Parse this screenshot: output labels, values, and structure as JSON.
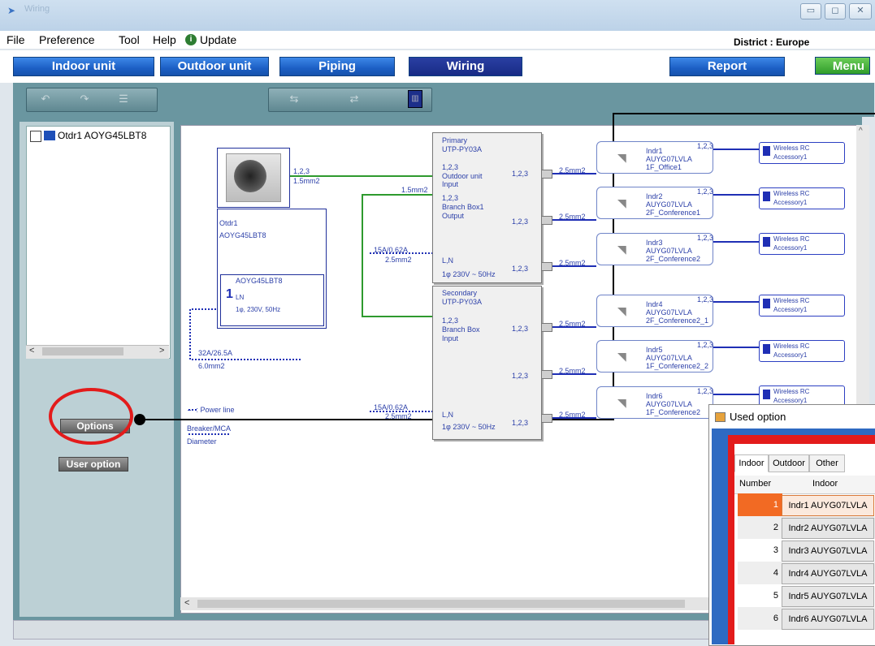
{
  "window": {
    "title": "Wiring",
    "minimize": "▭",
    "maximize": "◻",
    "close": "✕"
  },
  "menubar": {
    "file": "File",
    "preference": "Preference",
    "tool": "Tool",
    "help": "Help",
    "update": "Update",
    "district": "District : Europe"
  },
  "nav": {
    "indoor": "Indoor unit",
    "outdoor": "Outdoor unit",
    "piping": "Piping",
    "wiring": "Wiring",
    "report": "Report",
    "menu": "Menu"
  },
  "tree": {
    "item": "Otdr1 AOYG45LBT8"
  },
  "left": {
    "options": "Options",
    "user_option": "User option"
  },
  "outdoor": {
    "name1": "Otdr1",
    "name2": "AOYG45LBT8",
    "inner_model": "AOYG45LBT8",
    "number": "1",
    "ln": "LN",
    "supply": "1φ, 230V, 50Hz",
    "cable_spec": "1,2,3",
    "cable_size": "1.5mm2",
    "cable_size2": "1.5mm2",
    "breaker": "32A/26.5A",
    "breaker_size": "6.0mm2",
    "line1": "15A/0.62A",
    "line1_size": "2.5mm2",
    "line2": "15A/0.62A",
    "line2_size": "2.5mm2"
  },
  "legend": {
    "power": "··· : Power line",
    "breaker": "Breaker/MCA",
    "diameter": "Diameter"
  },
  "primary": {
    "title": "Primary",
    "model": "UTP-PY03A",
    "t1": "1,2,3",
    "t2": "Outdoor unit",
    "t3": "Input",
    "t4": "1,2,3",
    "t5": "Branch Box1",
    "t6": "Output",
    "ln": "L,N",
    "supply": "1φ 230V ~ 50Hz",
    "p1": "1,2,3",
    "p2": "1,2,3",
    "p3": "1,2,3"
  },
  "secondary": {
    "title": "Secondary",
    "model": "UTP-PY03A",
    "t1": "1,2,3",
    "t2": "Branch Box",
    "t3": "Input",
    "ln": "L,N",
    "supply": "1φ 230V ~ 50Hz",
    "p1": "1,2,3",
    "p2": "1,2,3",
    "p3": "1,2,3"
  },
  "cable": "2.5mm2",
  "indoor_units": [
    {
      "name": "Indr1",
      "model": "AUYG07LVLA",
      "room": "1F_Office1",
      "term": "1,2,3"
    },
    {
      "name": "Indr2",
      "model": "AUYG07LVLA",
      "room": "2F_Conference1",
      "term": "1,2,3"
    },
    {
      "name": "Indr3",
      "model": "AUYG07LVLA",
      "room": "2F_Conference2",
      "term": "1,2,3"
    },
    {
      "name": "Indr4",
      "model": "AUYG07LVLA",
      "room": "2F_Conference2_1",
      "term": "1,2,3"
    },
    {
      "name": "Indr5",
      "model": "AUYG07LVLA",
      "room": "1F_Conference2_2",
      "term": "1,2,3"
    },
    {
      "name": "Indr6",
      "model": "AUYG07LVLA",
      "room": "1F_Conference2",
      "term": "1,2,3"
    }
  ],
  "rc": {
    "line1": "Wireless RC",
    "line2": "Accessory1"
  },
  "dialog": {
    "title": "Used option",
    "tabs": [
      "Indoor",
      "Outdoor",
      "Other"
    ],
    "col_number": "Number",
    "col_indoor": "Indoor",
    "rows": [
      {
        "n": "1",
        "v": "Indr1 AUYG07LVLA"
      },
      {
        "n": "2",
        "v": "Indr2 AUYG07LVLA"
      },
      {
        "n": "3",
        "v": "Indr3 AUYG07LVLA"
      },
      {
        "n": "4",
        "v": "Indr4 AUYG07LVLA"
      },
      {
        "n": "5",
        "v": "Indr5 AUYG07LVLA"
      },
      {
        "n": "6",
        "v": "Indr6 AUYG07LVLA"
      }
    ]
  },
  "colors": {
    "accent": "#1c5fc4",
    "active": "#182b86",
    "menu": "#2f9c2a",
    "highlight": "#e31b1b"
  }
}
